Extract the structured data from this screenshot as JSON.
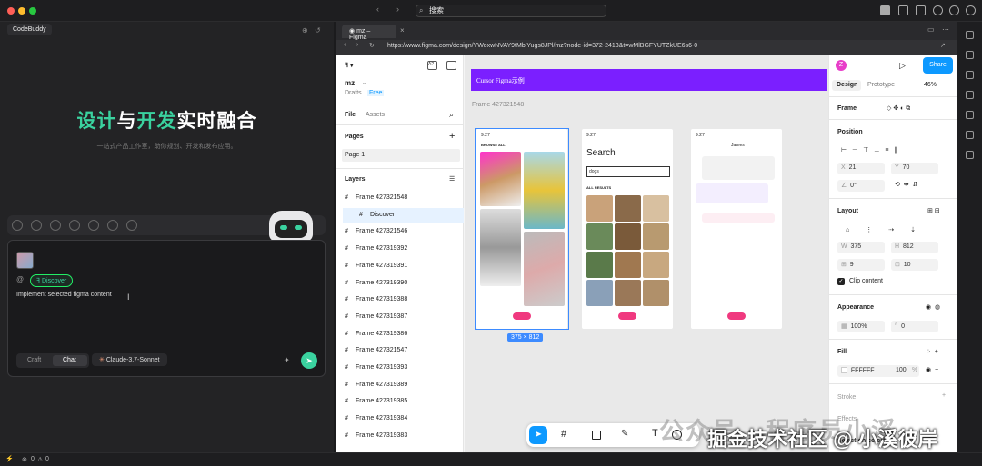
{
  "topbar": {
    "search": "搜索"
  },
  "left": {
    "tab": "CodeBuddy",
    "hero_a": "设计",
    "hero_b": "与",
    "hero_c": "开发",
    "hero_d": "实时融合",
    "subtitle": "一站式产品工作室，助你规划、开发和发布应用。",
    "at": "@",
    "chip": "Discover",
    "prompt": "Implement selected figma content",
    "mode_craft": "Craft",
    "mode_chat": "Chat",
    "model": "Claude-3.7-Sonnet"
  },
  "status": {
    "errors": "0",
    "warnings": "0"
  },
  "browser": {
    "tab": "mz – Figma",
    "url": "https://www.figma.com/design/YWoxwNVAY9tMbiYugs8JPl/mz?node-id=372-2413&t=wMlBGFYUTZkUE6s6-0"
  },
  "figma_left": {
    "file_name": "mz",
    "drafts": "Drafts",
    "free": "Free",
    "tab_file": "File",
    "tab_assets": "Assets",
    "pages": "Pages",
    "page1": "Page 1",
    "layers": "Layers",
    "layer_items": [
      "Frame 427321548",
      "Discover",
      "Frame 427321546",
      "Frame 427319392",
      "Frame 427319391",
      "Frame 427319390",
      "Frame 427319388",
      "Frame 427319387",
      "Frame 427319386",
      "Frame 427321547",
      "Frame 427319393",
      "Frame 427319389",
      "Frame 427319385",
      "Frame 427319384",
      "Frame 427319383"
    ]
  },
  "canvas": {
    "banner": "Cursor Figma示例",
    "frame_label": "Frame 427321548",
    "dimension": "375 × 812",
    "phone1_time": "9:27",
    "phone1_title": "BROWSE ALL",
    "phone2_time": "9:27",
    "phone2_title": "Search",
    "phone2_input": "dogs",
    "phone2_results": "ALL RESULTS",
    "phone3_time": "9:27",
    "phone3_name": "James"
  },
  "figma_right": {
    "avatar": "Z",
    "share": "Share",
    "tab_design": "Design",
    "tab_prototype": "Prototype",
    "zoom": "46%",
    "frame": "Frame",
    "position": "Position",
    "x_label": "X",
    "x": "21",
    "y_label": "Y",
    "y": "70",
    "rotation": "0°",
    "layout": "Layout",
    "w_label": "W",
    "w": "375",
    "h_label": "H",
    "h": "812",
    "gap1": "9",
    "gap2": "10",
    "clip": "Clip content",
    "appearance": "Appearance",
    "opacity": "100%",
    "radius": "0",
    "fill": "Fill",
    "fill_hex": "FFFFFF",
    "fill_opacity": "100",
    "fill_pct": "%",
    "stroke": "Stroke",
    "effects": "Effects",
    "selection_colors": "Selection colors"
  },
  "watermark": {
    "line1": "公众号 · 程序员小溪",
    "line2": "掘金技术社区 @ 小溪彼岸"
  }
}
